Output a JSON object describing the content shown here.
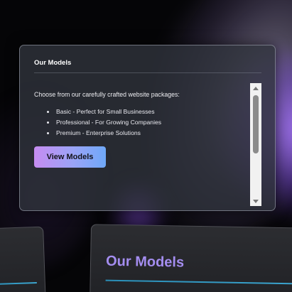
{
  "card": {
    "title": "Our Models",
    "intro": "Choose from our carefully crafted website packages:",
    "packages": [
      "Basic - Perfect for Small Businesses",
      "Professional - For Growing Companies",
      "Premium - Enterprise Solutions"
    ],
    "button_label": "View Models",
    "button_gradient": [
      "#c68cf1",
      "#6fa8f8"
    ]
  },
  "section": {
    "title": "Our Models",
    "accent": "#a48df0",
    "underline_color": "#2a8fb8"
  }
}
